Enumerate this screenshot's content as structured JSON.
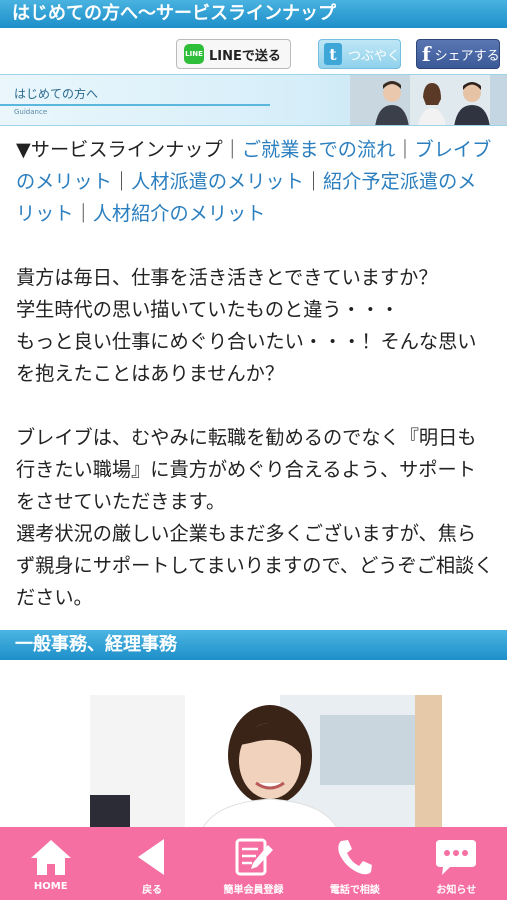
{
  "header": {
    "title": "はじめての方へ〜サービスラインナップ"
  },
  "share": {
    "line_label": "LINEで送る",
    "line_icon_text": "LINE",
    "tweet_label": "つぶやく",
    "share_label": "シェアする"
  },
  "banner": {
    "title": "はじめての方へ",
    "subtitle": "Guidance"
  },
  "nav_links": {
    "prefix": "▼サービスラインナップ",
    "separator": "｜",
    "items": [
      "ご就業までの流れ",
      "ブレイブのメリット",
      "人材派遣のメリット",
      "紹介予定派遣のメリット",
      "人材紹介のメリット"
    ]
  },
  "body": {
    "para1": [
      "貴方は毎日、仕事を活き活きとできていますか？",
      "学生時代の思い描いていたものと違う・・・",
      "もっと良い仕事にめぐり合いたい・・・！そんな思いを抱えたことはありませんか？"
    ],
    "para2": [
      "ブレイブは、むやみに転職を勧めるのでなく『明日も行きたい職場』に貴方がめぐり合えるよう、サポートをさせていただきます。",
      "選考状況の厳しい企業もまだ多くございますが、焦らず親身にサポートしてまいりますので、どうぞご相談ください。"
    ]
  },
  "section": {
    "title": "一般事務、経理事務"
  },
  "bottom_nav": {
    "items": [
      {
        "label": "HOME",
        "icon": "home-icon"
      },
      {
        "label": "戻る",
        "icon": "back-icon"
      },
      {
        "label": "簡単会員登録",
        "icon": "register-icon"
      },
      {
        "label": "電話で相談",
        "icon": "phone-icon"
      },
      {
        "label": "お知らせ",
        "icon": "chat-icon"
      }
    ]
  },
  "colors": {
    "accent_blue": "#1d8fc9",
    "link_blue": "#2c7fbf",
    "nav_pink": "#f66fa2"
  }
}
